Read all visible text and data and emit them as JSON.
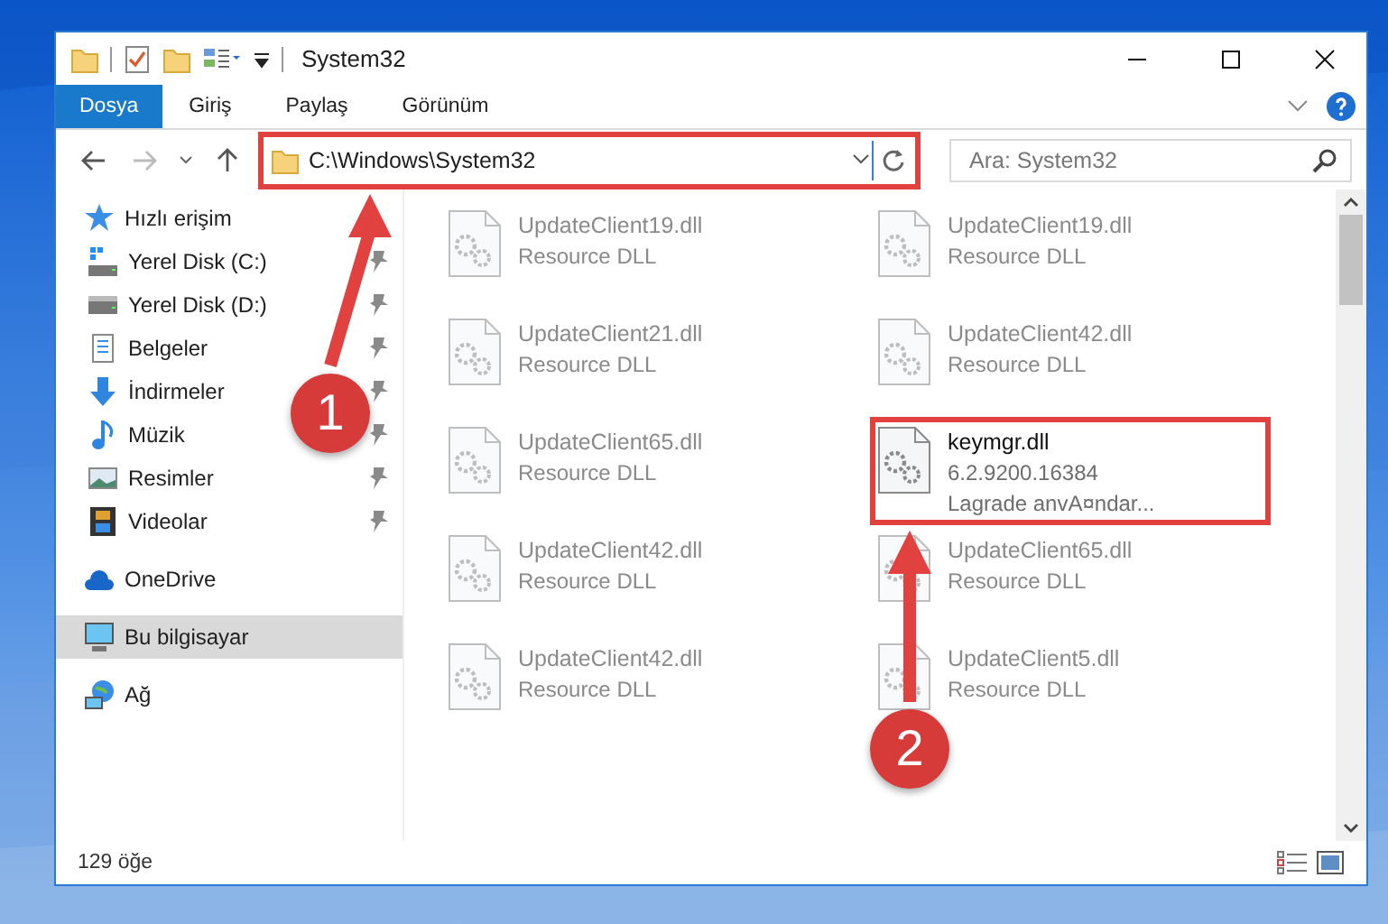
{
  "window": {
    "title": "System32"
  },
  "ribbon_tabs": [
    {
      "label": "Dosya",
      "selected": true
    },
    {
      "label": "Giriş",
      "selected": false
    },
    {
      "label": "Paylaş",
      "selected": false
    },
    {
      "label": "Görünüm",
      "selected": false
    }
  ],
  "address_bar": {
    "path": "C:\\Windows\\System32",
    "highlighted": true,
    "callout": "1"
  },
  "search": {
    "placeholder": "Ara: System32"
  },
  "sidebar": {
    "groups": [
      {
        "label": "Hızlı erişim",
        "kind": "star",
        "selected": false,
        "children": [
          {
            "label": "Yerel Disk (C:)",
            "kind": "system-drive",
            "selected": false
          },
          {
            "label": "Yerel Disk (D:)",
            "kind": "drive",
            "selected": false
          },
          {
            "label": "Belgeler",
            "kind": "documents",
            "selected": false
          },
          {
            "label": "İndirmeler",
            "kind": "download",
            "selected": false
          },
          {
            "label": "Müzik",
            "kind": "music",
            "selected": false
          },
          {
            "label": "Resimler",
            "kind": "pictures",
            "selected": false
          },
          {
            "label": "Videolar",
            "kind": "video",
            "selected": false
          }
        ]
      },
      {
        "label": "OneDrive",
        "kind": "cloud",
        "selected": false
      },
      {
        "label": "Bu bilgisayar",
        "kind": "computer",
        "selected": true
      },
      {
        "label": "Ağ",
        "kind": "network",
        "selected": false
      }
    ]
  },
  "files": [
    {
      "name": "UpdateClient19.dll",
      "details": [
        "Resource DLL"
      ],
      "dimmed": true,
      "highlighted": false
    },
    {
      "name": "UpdateClient19.dll",
      "details": [
        "Resource DLL"
      ],
      "dimmed": true,
      "highlighted": false
    },
    {
      "name": "UpdateClient21.dll",
      "details": [
        "Resource DLL"
      ],
      "dimmed": true,
      "highlighted": false
    },
    {
      "name": "UpdateClient42.dll",
      "details": [
        "Resource DLL"
      ],
      "dimmed": true,
      "highlighted": false
    },
    {
      "name": "UpdateClient65.dll",
      "details": [
        "Resource DLL"
      ],
      "dimmed": true,
      "highlighted": false
    },
    {
      "name": "keymgr.dll",
      "details": [
        "6.2.9200.16384",
        "Lagrade anvA¤ndar..."
      ],
      "dimmed": false,
      "highlighted": true,
      "callout": "2"
    },
    {
      "name": "UpdateClient42.dll",
      "details": [
        "Resource DLL"
      ],
      "dimmed": true,
      "highlighted": false
    },
    {
      "name": "UpdateClient65.dll",
      "details": [
        "Resource DLL"
      ],
      "dimmed": true,
      "highlighted": false
    },
    {
      "name": "UpdateClient42.dll",
      "details": [
        "Resource DLL"
      ],
      "dimmed": true,
      "highlighted": false
    },
    {
      "name": "UpdateClient5.dll",
      "details": [
        "Resource DLL"
      ],
      "dimmed": true,
      "highlighted": false
    }
  ],
  "status_bar": {
    "item_count": "129 öğe"
  }
}
